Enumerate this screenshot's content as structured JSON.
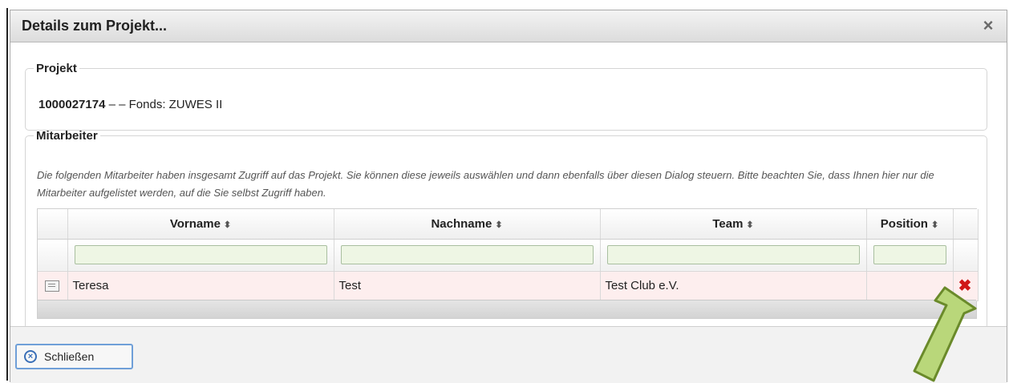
{
  "dialog": {
    "title": "Details zum Projekt...",
    "close_icon": "×"
  },
  "projekt": {
    "legend": "Projekt",
    "number": "1000027174",
    "separator": " – – ",
    "fonds": "Fonds: ZUWES II"
  },
  "mitarbeiter": {
    "legend": "Mitarbeiter",
    "description": "Die folgenden Mitarbeiter haben insgesamt Zugriff auf das Projekt. Sie können diese jeweils auswählen und dann ebenfalls über diesen Dialog steuern. Bitte beachten Sie, dass Ihnen hier nur die Mitarbeiter aufgelistet werden, auf die Sie selbst Zugriff haben.",
    "columns": [
      "Vorname",
      "Nachname",
      "Team",
      "Position"
    ],
    "sort_glyph": "⬍",
    "rows": [
      {
        "vorname": "Teresa",
        "nachname": "Test",
        "team": "Test Club e.V.",
        "position": ""
      }
    ]
  },
  "buttons": {
    "close_label": "Schließen",
    "close_glyph": "×"
  },
  "colors": {
    "row_highlight": "#fdeeee",
    "delete_red": "#d01818",
    "arrow_green": "#b9d77a"
  },
  "icons": {
    "row_icon": "card-icon",
    "delete_icon": "✖",
    "dialog_close": "close-icon"
  }
}
